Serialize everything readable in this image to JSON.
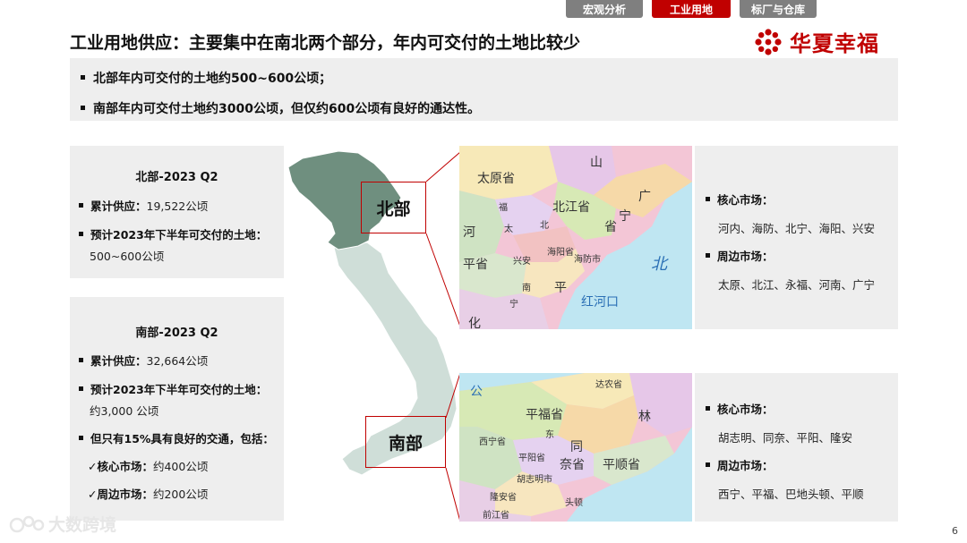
{
  "nav": {
    "tabs": [
      {
        "label": "宏观分析",
        "color": "#7f7f7f"
      },
      {
        "label": "工业用地",
        "color": "#c00000",
        "active": true
      },
      {
        "label": "标厂与仓库",
        "color": "#7f7f7f"
      }
    ]
  },
  "header": {
    "title": "工业用地供应：主要集中在南北两个部分，年内可交付的土地比较少",
    "logo_text": "华夏幸福"
  },
  "summary": {
    "lines": [
      "北部年内可交付的土地约500~600公顷；",
      "南部年内可交付土地约3000公顷，但仅约600公顷有良好的通达性。"
    ]
  },
  "north_panel": {
    "title": "北部-2023 Q2",
    "supply_label": "累计供应：",
    "supply_value": "19,522公顷",
    "deliverable_label": "预计2023年下半年可交付的土地：",
    "deliverable_value": "500~600公顷"
  },
  "south_panel": {
    "title": "南部-2023 Q2",
    "supply_label": "累计供应：",
    "supply_value": "32,664公顷",
    "deliverable_label": "预计2023年下半年可交付的土地：",
    "deliverable_value": "约3,000 公顷",
    "access_label": "但只有15%具有良好的交通，包括：",
    "core_label": "✓核心市场：",
    "core_value": "约400公顷",
    "peripheral_label": "✓周边市场：",
    "peripheral_value": "约200公顷"
  },
  "map": {
    "north_label": "北部",
    "south_label": "南部"
  },
  "north_map": {
    "labels": [
      "太原省",
      "山",
      "北江省",
      "广",
      "宁",
      "省",
      "河",
      "平省",
      "海阳省",
      "海防市",
      "北",
      "红河口",
      "化",
      "平"
    ],
    "small_labels": [
      "福",
      "兴安",
      "宁",
      "南",
      "太",
      "北"
    ]
  },
  "south_map": {
    "labels": [
      "达农省",
      "平福省",
      "林",
      "同",
      "奈省",
      "平顺省",
      "西宁省",
      "平阳省",
      "胡志明市",
      "隆安省",
      "公"
    ],
    "small_labels": [
      "东",
      "前江省",
      "头顿"
    ]
  },
  "north_side": {
    "core_label": "核心市场：",
    "core_value": "河内、海防、北宁、海阳、兴安",
    "peripheral_label": "周边市场：",
    "peripheral_value": "太原、北江、永福、河南、广宁"
  },
  "south_side": {
    "core_label": "核心市场：",
    "core_value": "胡志明、同奈、平阳、隆安",
    "peripheral_label": "周边市场：",
    "peripheral_value": "西宁、平福、巴地头顿、平顺"
  },
  "watermark": "大数跨境",
  "page_number": "6",
  "colors": {
    "accent": "#c00000",
    "tab_gray": "#7f7f7f",
    "panel_bg": "#eeeeee",
    "map_north": "#6f8f7f",
    "map_south": "#cfded8"
  }
}
